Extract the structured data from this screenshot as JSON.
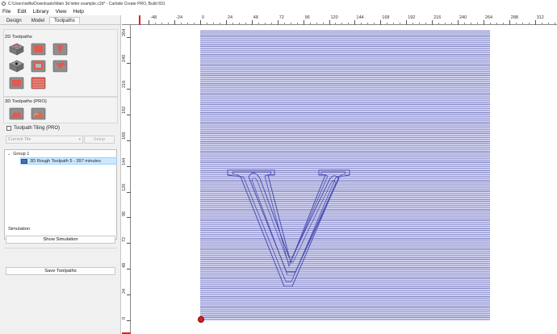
{
  "window": {
    "title": "C:\\Users\\wilfa\\Downloads\\Main 3d letter example.c2d* - Carbide Create PRO, Build 831"
  },
  "menu": [
    "File",
    "Edit",
    "Library",
    "View",
    "Help"
  ],
  "tabs": {
    "design": "Design",
    "model": "Model",
    "toolpaths": "Toolpaths"
  },
  "panel": {
    "toolpaths_2d_label": "2D Toolpaths",
    "toolpaths_3d_label": "3D Toolpaths (PRO)",
    "tiling_label": "Toolpath Tiling (PRO)",
    "tile_select_value": "Current Tile",
    "setup_button": "Setup"
  },
  "tree": {
    "group_label": "Group 1",
    "toolpath_label": "3D Rough Toolpath 5 - 397 minutes"
  },
  "simulation": {
    "label": "Simulation",
    "show_button": "Show Simulation",
    "save_button": "Save Toolpaths"
  },
  "ruler": {
    "top_ticks": [
      "-48",
      "-24",
      "0",
      "24",
      "48",
      "72",
      "96",
      "120",
      "144",
      "168",
      "192",
      "216",
      "240",
      "264",
      "288",
      "312",
      "336"
    ],
    "left_ticks": [
      "264",
      "240",
      "216",
      "192",
      "168",
      "144",
      "120",
      "96",
      "72",
      "48",
      "24",
      "0"
    ]
  },
  "colors": {
    "toolpath_line": "#4a4fb0",
    "stock_fill": "#dcdcf2",
    "selection": "#cce8ff",
    "origin": "#d32020"
  }
}
